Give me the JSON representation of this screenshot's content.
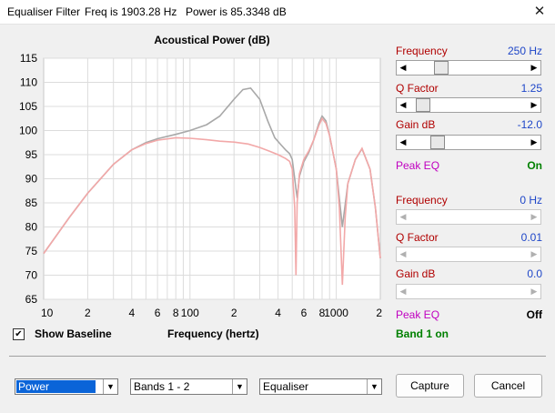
{
  "window": {
    "title": "Equaliser Filter",
    "freq_status": "Freq is 1903.28 Hz",
    "power_status": "Power is 85.3348 dB",
    "close_glyph": "✕"
  },
  "chart_data": {
    "type": "line",
    "title": "Acoustical Power (dB)",
    "xlabel": "Frequency (hertz)",
    "ylabel": "",
    "x_scale": "log",
    "xlim": [
      10,
      2000
    ],
    "ylim": [
      65,
      115
    ],
    "yticks": [
      "115",
      "110",
      "105",
      "100",
      "95",
      "90",
      "85",
      "80",
      "75",
      "70",
      "65"
    ],
    "xticks": [
      {
        "v": 10,
        "label": "10"
      },
      {
        "v": 20,
        "label": "2"
      },
      {
        "v": 40,
        "label": "4"
      },
      {
        "v": 60,
        "label": "6"
      },
      {
        "v": 80,
        "label": "8"
      },
      {
        "v": 100,
        "label": "100"
      },
      {
        "v": 200,
        "label": "2"
      },
      {
        "v": 400,
        "label": "4"
      },
      {
        "v": 600,
        "label": "6"
      },
      {
        "v": 800,
        "label": "8"
      },
      {
        "v": 1000,
        "label": "1000"
      },
      {
        "v": 2000,
        "label": "2"
      }
    ],
    "grid": true,
    "series": [
      {
        "color": "#a8a8a8",
        "x": [
          10,
          15,
          20,
          30,
          40,
          50,
          60,
          80,
          100,
          130,
          160,
          200,
          230,
          260,
          300,
          340,
          380,
          420,
          450,
          480,
          500,
          520,
          540,
          560,
          600,
          650,
          700,
          760,
          800,
          850,
          900,
          1000,
          1100,
          1200,
          1350,
          1500,
          1700,
          1850,
          2000
        ],
        "y": [
          74.5,
          82,
          87,
          93,
          96,
          97.5,
          98.3,
          99.2,
          100,
          101.2,
          103,
          106.5,
          108.5,
          108.8,
          106.5,
          102,
          98.5,
          97,
          96,
          95.2,
          94,
          90,
          86,
          90.5,
          93.5,
          95.5,
          98,
          101.5,
          103,
          102,
          99,
          92,
          80,
          89,
          94,
          96.2,
          92,
          84,
          73.5
        ]
      },
      {
        "color": "#f2a8a8",
        "x": [
          10,
          15,
          20,
          30,
          40,
          50,
          60,
          80,
          100,
          130,
          160,
          200,
          250,
          300,
          350,
          400,
          450,
          480,
          500,
          520,
          530,
          540,
          560,
          600,
          650,
          700,
          760,
          800,
          850,
          900,
          1000,
          1050,
          1100,
          1150,
          1200,
          1350,
          1500,
          1700,
          1850,
          2000
        ],
        "y": [
          74.5,
          82,
          87,
          93,
          96,
          97.3,
          98,
          98.5,
          98.4,
          98.1,
          97.8,
          97.6,
          97.2,
          96.5,
          95.7,
          95,
          94.2,
          93.6,
          92,
          84,
          70,
          85,
          91,
          94,
          95.8,
          98,
          101,
          102.5,
          101.5,
          99,
          92,
          84,
          68,
          82,
          89,
          94,
          96.3,
          92,
          84,
          73.5
        ]
      }
    ]
  },
  "band1": {
    "frequency_label": "Frequency",
    "frequency_value": "250 Hz",
    "q_label": "Q Factor",
    "q_value": "1.25",
    "gain_label": "Gain  dB",
    "gain_value": "-12.0",
    "type_label": "Peak EQ",
    "state": "On",
    "freq_pos": 0.24,
    "q_pos": 0.06,
    "gain_pos": 0.2
  },
  "band2": {
    "frequency_label": "Frequency",
    "frequency_value": "0 Hz",
    "q_label": "Q Factor",
    "q_value": "0.01",
    "gain_label": "Gain  dB",
    "gain_value": "0.0",
    "type_label": "Peak EQ",
    "state": "Off"
  },
  "arrows": {
    "left": "◀",
    "right": "▶",
    "down": "▼"
  },
  "band_status": "Band 1 on",
  "show_baseline": {
    "label": "Show Baseline",
    "checked_glyph": "✔"
  },
  "controls": {
    "mode_select": "Power",
    "bands_select": "Bands 1 - 2",
    "type_select": "Equaliser",
    "capture": "Capture",
    "cancel": "Cancel"
  }
}
